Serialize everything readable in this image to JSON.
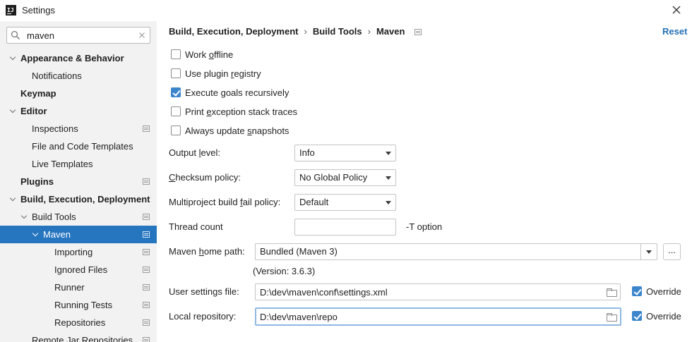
{
  "window": {
    "title": "Settings",
    "app_icon_text": "IJ"
  },
  "search": {
    "value": "maven",
    "placeholder": ""
  },
  "tree": [
    {
      "label": "Appearance & Behavior",
      "bold": true,
      "chevron": "down",
      "indent": 0,
      "proj_icon": false,
      "selected": false
    },
    {
      "label": "Notifications",
      "bold": false,
      "chevron": "none",
      "indent": 1,
      "proj_icon": false,
      "selected": false
    },
    {
      "label": "Keymap",
      "bold": true,
      "chevron": "none",
      "indent": 0,
      "proj_icon": false,
      "selected": false
    },
    {
      "label": "Editor",
      "bold": true,
      "chevron": "down",
      "indent": 0,
      "proj_icon": false,
      "selected": false
    },
    {
      "label": "Inspections",
      "bold": false,
      "chevron": "none",
      "indent": 1,
      "proj_icon": true,
      "selected": false
    },
    {
      "label": "File and Code Templates",
      "bold": false,
      "chevron": "none",
      "indent": 1,
      "proj_icon": false,
      "selected": false
    },
    {
      "label": "Live Templates",
      "bold": false,
      "chevron": "none",
      "indent": 1,
      "proj_icon": false,
      "selected": false
    },
    {
      "label": "Plugins",
      "bold": true,
      "chevron": "none",
      "indent": 0,
      "proj_icon": true,
      "selected": false
    },
    {
      "label": "Build, Execution, Deployment",
      "bold": true,
      "chevron": "down",
      "indent": 0,
      "proj_icon": false,
      "selected": false
    },
    {
      "label": "Build Tools",
      "bold": false,
      "chevron": "down",
      "indent": 1,
      "proj_icon": true,
      "selected": false
    },
    {
      "label": "Maven",
      "bold": false,
      "chevron": "down",
      "indent": 2,
      "proj_icon": true,
      "selected": true
    },
    {
      "label": "Importing",
      "bold": false,
      "chevron": "none",
      "indent": 3,
      "proj_icon": true,
      "selected": false
    },
    {
      "label": "Ignored Files",
      "bold": false,
      "chevron": "none",
      "indent": 3,
      "proj_icon": true,
      "selected": false
    },
    {
      "label": "Runner",
      "bold": false,
      "chevron": "none",
      "indent": 3,
      "proj_icon": true,
      "selected": false
    },
    {
      "label": "Running Tests",
      "bold": false,
      "chevron": "none",
      "indent": 3,
      "proj_icon": true,
      "selected": false
    },
    {
      "label": "Repositories",
      "bold": false,
      "chevron": "none",
      "indent": 3,
      "proj_icon": true,
      "selected": false
    },
    {
      "label": "Remote Jar Repositories",
      "bold": false,
      "chevron": "none",
      "indent": 1,
      "proj_icon": true,
      "selected": false
    }
  ],
  "header": {
    "crumbs": [
      "Build, Execution, Deployment",
      "Build Tools",
      "Maven"
    ],
    "separator": "›",
    "reset_label": "Reset"
  },
  "options": {
    "work_offline": {
      "label_pre": "Work ",
      "label_u": "o",
      "label_post": "ffline",
      "checked": false
    },
    "plugin_registry": {
      "label_pre": "Use plugin ",
      "label_u": "r",
      "label_post": "egistry",
      "checked": false
    },
    "execute_goals": {
      "label_pre": "Execute ",
      "label_u": "g",
      "label_post": "oals recursively",
      "checked": true
    },
    "print_exception": {
      "label_pre": "Print ",
      "label_u": "e",
      "label_post": "xception stack traces",
      "checked": false
    },
    "always_update": {
      "label_pre": "Always update ",
      "label_u": "s",
      "label_post": "napshots",
      "checked": false
    }
  },
  "fields": {
    "output_level": {
      "label_pre": "Output ",
      "label_u": "l",
      "label_post": "evel:",
      "value": "Info"
    },
    "checksum_policy": {
      "label_pre": "",
      "label_u": "C",
      "label_post": "hecksum policy:",
      "value": "No Global Policy"
    },
    "multiproject": {
      "label_pre": "Multiproject build ",
      "label_u": "f",
      "label_post": "ail policy:",
      "value": "Default"
    },
    "thread_count": {
      "label": "Thread count",
      "value": "",
      "hint": "-T option"
    },
    "maven_home": {
      "label_pre": "Maven ",
      "label_u": "h",
      "label_post": "ome path:",
      "value": "Bundled (Maven 3)",
      "browse": "...",
      "version": "(Version: 3.6.3)"
    },
    "user_settings": {
      "label": "User settings file:",
      "value": "D:\\dev\\maven\\conf\\settings.xml",
      "override_label": "Override",
      "override_checked": true
    },
    "local_repo": {
      "label": "Local repository:",
      "value": "D:\\dev\\maven\\repo",
      "override_label": "Override",
      "override_checked": true
    }
  },
  "colors": {
    "selection": "#2675bf",
    "accent_link": "#2470b3",
    "checkbox": "#3b85cc",
    "sidebar_bg": "#f2f2f2"
  }
}
